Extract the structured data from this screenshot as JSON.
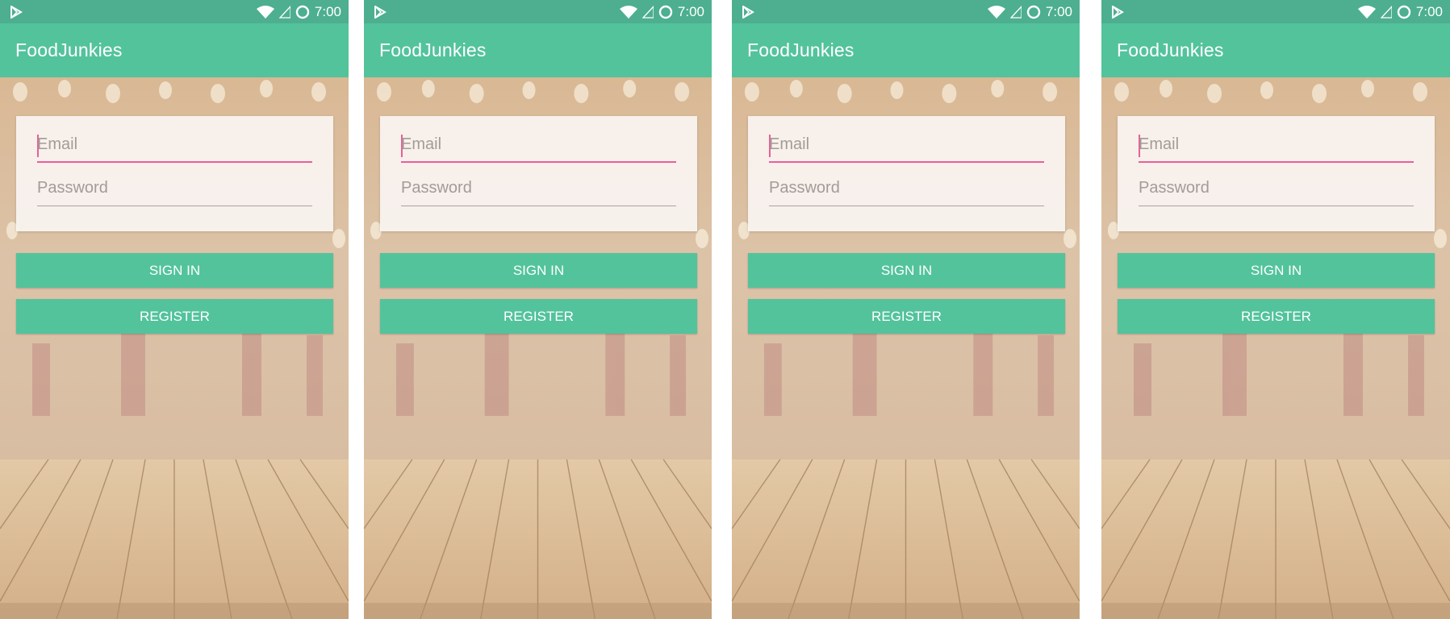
{
  "status_bar": {
    "time": "7:00",
    "icons": [
      "play-store-icon",
      "wifi-icon",
      "signal-icon",
      "sync-circle-icon"
    ]
  },
  "app": {
    "title": "FoodJunkies"
  },
  "form": {
    "email_placeholder": "Email",
    "password_placeholder": "Password",
    "sign_in_label": "SIGN IN",
    "register_label": "REGISTER"
  },
  "colors": {
    "status_bar": "#4daf8f",
    "app_bar": "#53c39c",
    "button": "#53c39c",
    "focus_underline": "#e8609a"
  }
}
